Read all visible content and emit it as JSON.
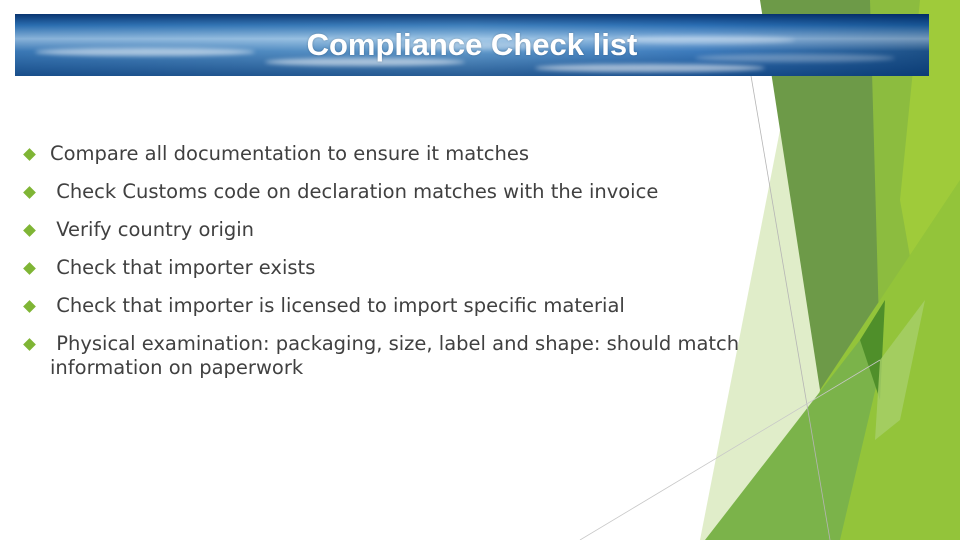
{
  "slide": {
    "title": "Compliance Check list",
    "bullet_color": "#7fb535",
    "accent_colors": [
      "#6d9a48",
      "#8cbc3f",
      "#9fcb3a",
      "#d9e9be",
      "#4f8f2a"
    ],
    "bullets": [
      {
        "text": "Compare all documentation to ensure it matches"
      },
      {
        "text": " Check Customs code on declaration matches with the invoice"
      },
      {
        "text": " Verify country origin"
      },
      {
        "text": " Check that importer exists"
      },
      {
        "text": " Check that importer is licensed to import specific material"
      },
      {
        "text": " Physical examination: packaging, size, label and shape: should match information on paperwork"
      }
    ]
  }
}
